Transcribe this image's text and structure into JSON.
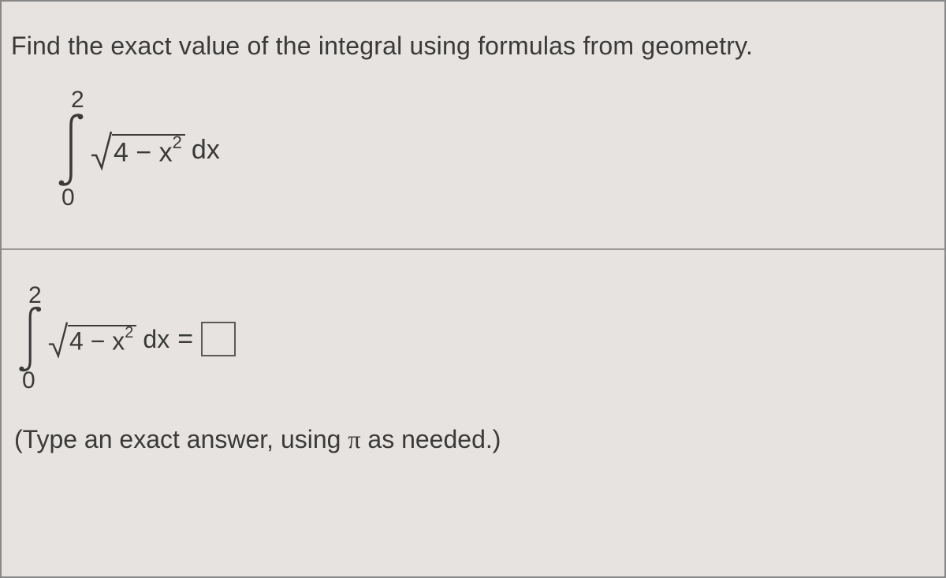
{
  "problem_text": "Find the exact value of the integral using formulas from geometry.",
  "integral1": {
    "upper": "2",
    "lower": "0",
    "radicand_const": "4",
    "radicand_var": "x",
    "radicand_exp": "2",
    "diff": "dx"
  },
  "integral2": {
    "upper": "2",
    "lower": "0",
    "radicand_const": "4",
    "radicand_var": "x",
    "radicand_exp": "2",
    "diff": "dx",
    "equals": "="
  },
  "answer_value": "",
  "hint_prefix": "(Type an exact answer, using ",
  "hint_pi": "π",
  "hint_suffix": " as needed.)"
}
